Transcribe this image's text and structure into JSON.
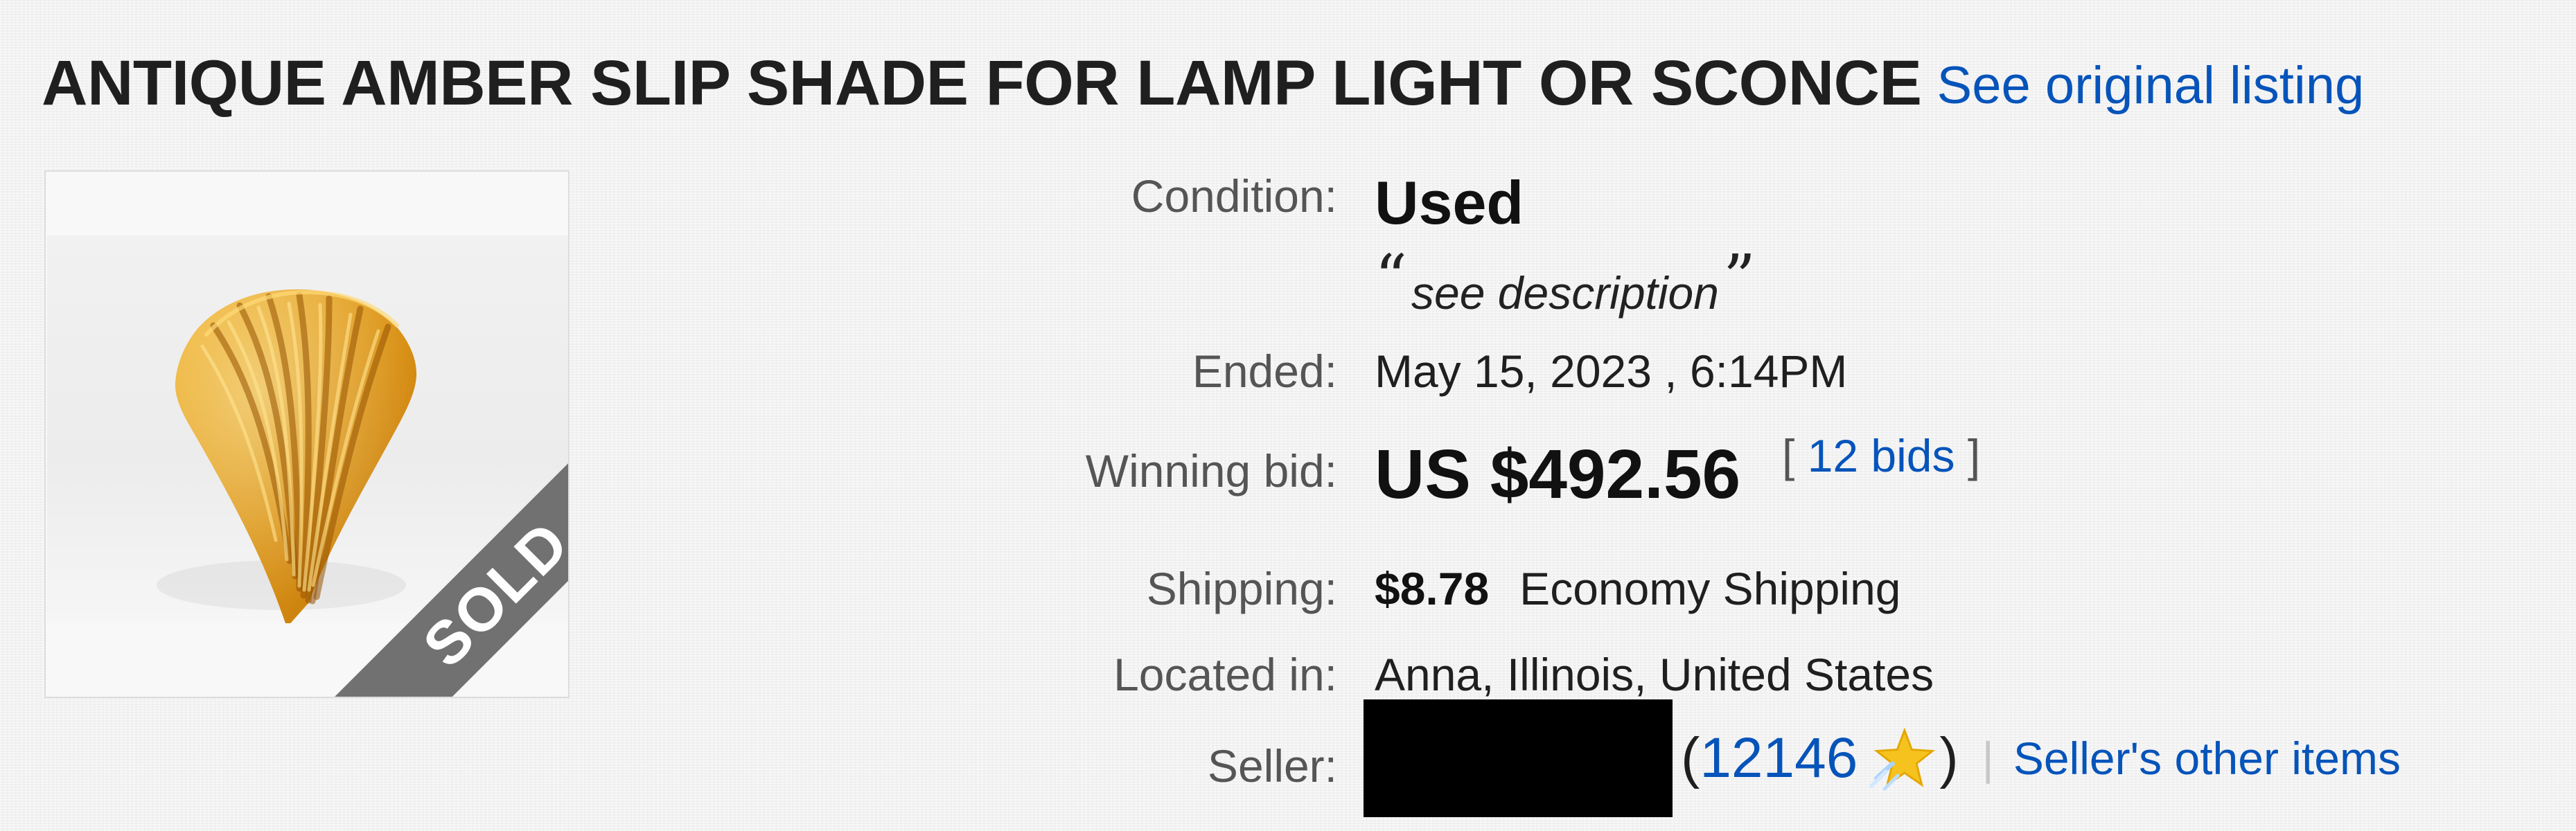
{
  "header": {
    "title": "ANTIQUE AMBER SLIP SHADE FOR LAMP LIGHT OR SCONCE",
    "original_listing_link": "See original listing"
  },
  "image": {
    "sold_badge": "SOLD"
  },
  "details": {
    "condition_label": "Condition:",
    "condition_value": "Used",
    "condition_note_open": "“",
    "condition_note": "see description",
    "condition_note_close": "”",
    "ended_label": "Ended:",
    "ended_value": "May 15, 2023 , 6:14PM",
    "winning_bid_label": "Winning bid:",
    "winning_bid_value": "US $492.56",
    "bids_open": "[",
    "bids_link": "12 bids",
    "bids_close": "]",
    "shipping_label": "Shipping:",
    "shipping_price": "$8.78",
    "shipping_method": "Economy Shipping",
    "located_label": "Located in:",
    "located_value": "Anna, Illinois, United States",
    "seller_label": "Seller:",
    "seller_score_open": "(",
    "seller_score": "12146",
    "seller_score_close": ")",
    "seller_divider": "|",
    "seller_other_items": "Seller's other items"
  },
  "icons": {
    "feedback_star": "star-icon"
  },
  "colors": {
    "link": "#0654ba",
    "sold_banner": "#6c6c6c",
    "product_amber": "#d89413"
  }
}
